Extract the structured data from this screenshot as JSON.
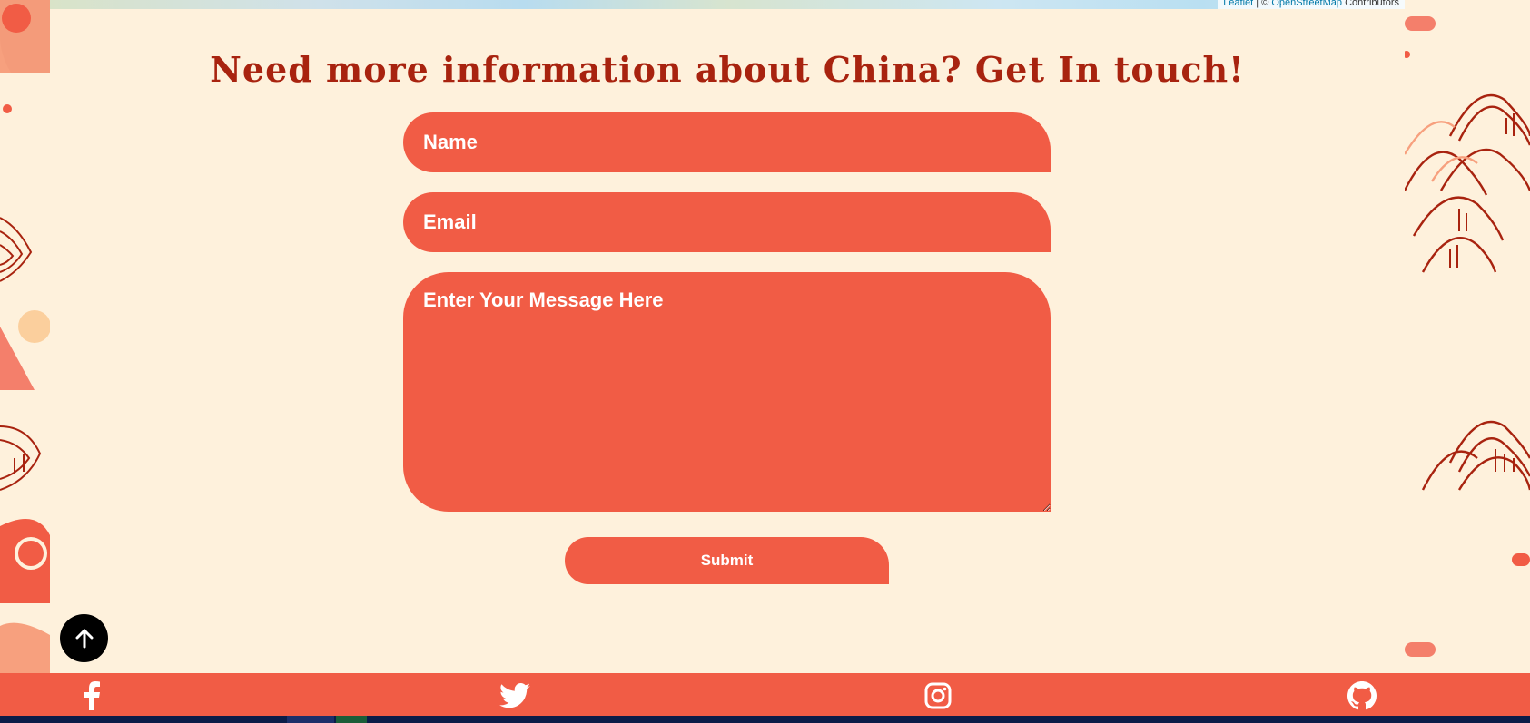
{
  "map": {
    "attribution_leaflet": "Leaflet",
    "attribution_separator": " | © ",
    "attribution_osm": "OpenStreetMap",
    "attribution_contributors": " Contributors"
  },
  "contact": {
    "title": "Need more information about China? Get In touch!",
    "name_placeholder": "Name",
    "email_placeholder": "Email",
    "message_placeholder": "Enter Your Message Here",
    "submit_label": "Submit"
  },
  "back_to_top": {
    "icon": "arrow-up-icon"
  },
  "footer": {
    "social": [
      {
        "name": "facebook",
        "icon": "facebook-icon"
      },
      {
        "name": "twitter",
        "icon": "twitter-icon"
      },
      {
        "name": "instagram",
        "icon": "instagram-icon"
      },
      {
        "name": "github",
        "icon": "github-icon"
      }
    ]
  },
  "colors": {
    "background": "#fef1dc",
    "accent": "#f15c45",
    "title": "#a8230f",
    "footer": "#f15c45",
    "back_to_top": "#000000"
  }
}
